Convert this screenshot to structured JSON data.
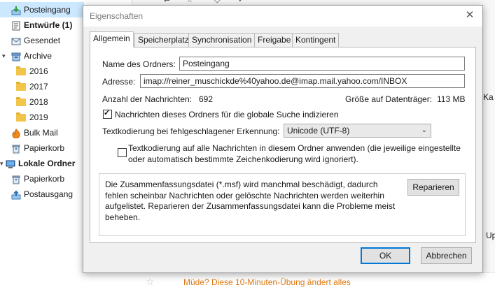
{
  "tree": {
    "items": [
      {
        "label": "Posteingang",
        "icon": "inbox-icon"
      },
      {
        "label": "Entwürfe (1)",
        "icon": "drafts-icon"
      },
      {
        "label": "Gesendet",
        "icon": "sent-icon"
      },
      {
        "label": "Archive",
        "icon": "archive-icon"
      },
      {
        "label": "2016",
        "icon": "folder-icon"
      },
      {
        "label": "2017",
        "icon": "folder-icon"
      },
      {
        "label": "2018",
        "icon": "folder-icon"
      },
      {
        "label": "2019",
        "icon": "folder-icon"
      },
      {
        "label": "Bulk Mail",
        "icon": "junk-icon"
      },
      {
        "label": "Papierkorb",
        "icon": "trash-icon"
      },
      {
        "label": "Lokale Ordner",
        "icon": "local-folders-icon"
      },
      {
        "label": "Papierkorb",
        "icon": "trash-icon"
      },
      {
        "label": "Postausgang",
        "icon": "outbox-icon"
      }
    ]
  },
  "background": {
    "message_subject": "Müde? Diese 10-Minuten-Übung ändert alles",
    "edge_ka": "Ka",
    "edge_up": "Up"
  },
  "dialog": {
    "title": "Eigenschaften",
    "tabs": [
      "Allgemein",
      "Speicherplatz",
      "Synchronisation",
      "Freigabe",
      "Kontingent"
    ],
    "folder_name_label": "Name des Ordners:",
    "folder_name_value": "Posteingang",
    "address_label": "Adresse:",
    "address_value": "imap://reiner_muschickde%40yahoo.de@imap.mail.yahoo.com/INBOX",
    "message_count_label": "Anzahl der Nachrichten:",
    "message_count_value": "692",
    "disk_size_label": "Größe auf Datenträger:",
    "disk_size_value": "113 MB",
    "index_checkbox_label": "Nachrichten dieses Ordners für die globale Suche indizieren",
    "index_checked": true,
    "encoding_label": "Textkodierung bei fehlgeschlagener Erkennung:",
    "encoding_value": "Unicode (UTF-8)",
    "apply_encoding_label_1": "Textkodierung auf alle Nachrichten in diesem Ordner anwenden (die jeweilige eingestellte",
    "apply_encoding_label_2": "oder automatisch bestimmte Zeichenkodierung wird ignoriert).",
    "apply_encoding_checked": false,
    "repair_info": "Die Zusammenfassungsdatei (*.msf) wird manchmal beschädigt, dadurch fehlen scheinbar Nachrichten oder gelöschte Nachrichten werden weiterhin aufgelistet. Reparieren der Zusammenfassungsdatei kann die Probleme meist beheben.",
    "repair_button": "Reparieren",
    "ok_button": "OK",
    "cancel_button": "Abbrechen"
  }
}
